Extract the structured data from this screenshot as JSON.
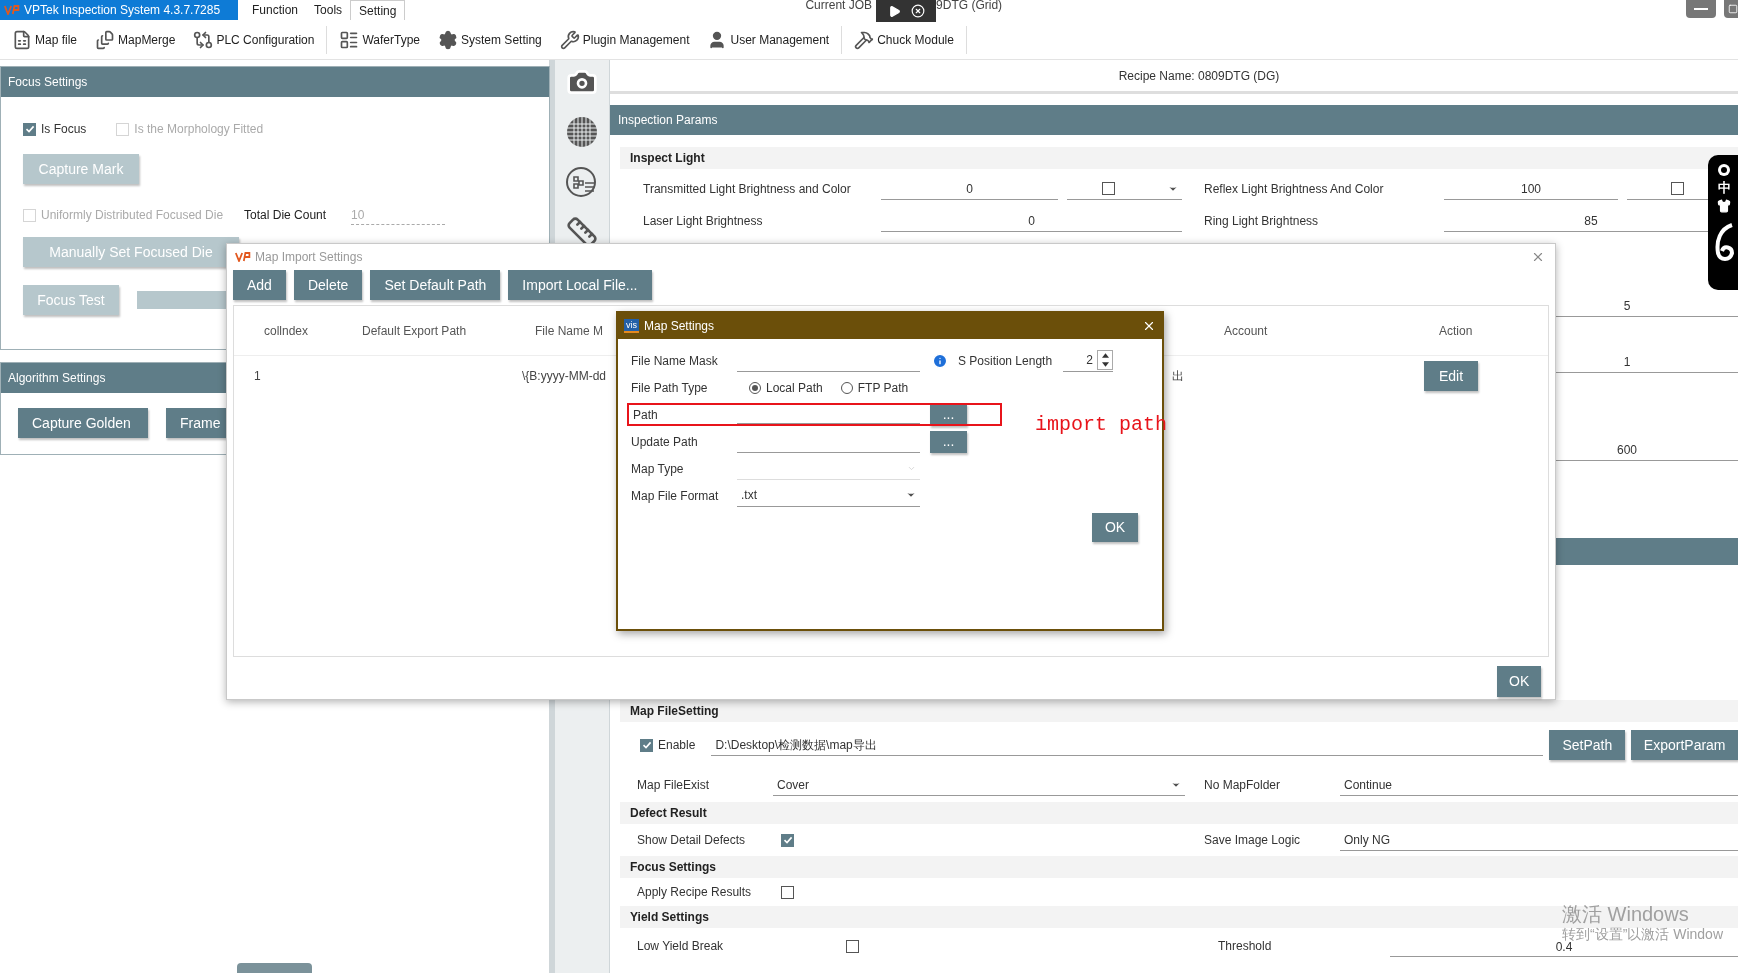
{
  "app": {
    "title": "VPTek Inspection System 4.3.7.7285",
    "job_left": "Current JOB",
    "job_right": "9DTG (Grid)"
  },
  "menus": [
    {
      "label": "Function",
      "selected": false
    },
    {
      "label": "Tools",
      "selected": false
    },
    {
      "label": "Setting",
      "selected": true
    }
  ],
  "toolbar": [
    {
      "label": "Map file"
    },
    {
      "label": "MapMerge"
    },
    {
      "label": "PLC Configuration"
    },
    {
      "label": "WaferType"
    },
    {
      "label": "System Setting"
    },
    {
      "label": "Plugin Management"
    },
    {
      "label": "User Management"
    },
    {
      "label": "Chuck Module"
    }
  ],
  "focus_settings": {
    "title": "Focus Settings",
    "is_focus": {
      "label": "Is Focus",
      "checked": true,
      "disabled": false
    },
    "morphology": {
      "label": "Is the Morphology Fitted",
      "checked": false,
      "disabled": true
    },
    "capture_mark": {
      "label": "Capture Mark",
      "disabled": true
    },
    "uniform": {
      "label": "Uniformly Distributed Focused Die",
      "checked": false,
      "disabled": true
    },
    "total_die_label": "Total Die Count",
    "total_die_value": "10",
    "manual": {
      "label": "Manually Set Focused Die",
      "disabled": true
    },
    "focus_test": {
      "label": "Focus Test",
      "disabled": true
    }
  },
  "algorithm_settings": {
    "title": "Algorithm Settings",
    "buttons": [
      {
        "label": "Capture Golden",
        "disabled": false
      },
      {
        "label": "Frame",
        "disabled": false
      }
    ]
  },
  "recipe": "Recipe Name: 0809DTG (DG)",
  "inspection_params": {
    "title": "Inspection Params",
    "section": "Inspect Light",
    "transmitted": {
      "label": "Transmitted Light Brightness and Color",
      "value": "0",
      "color_checked": false
    },
    "reflex": {
      "label": "Reflex Light Brightness And Color",
      "value": "100",
      "color_checked": false
    },
    "laser": {
      "label": "Laser Light Brightness",
      "value": "0"
    },
    "ring": {
      "label": "Ring Light Brightness",
      "value": "85"
    },
    "hidden_values": [
      "5",
      "1",
      "600"
    ]
  },
  "map_file_setting": {
    "title": "Map FileSetting",
    "enable": {
      "label": "Enable",
      "checked": true
    },
    "path": "D:\\Desktop\\检测数据\\map导出",
    "buttons": [
      "SetPath",
      "ExportParam"
    ],
    "exist_label": "Map FileExist",
    "exist_value": "Cover",
    "folder_label": "No MapFolder",
    "folder_value": "Continue"
  },
  "defect_result": {
    "title": "Defect Result",
    "show_detail": {
      "label": "Show Detail Defects",
      "checked": true
    },
    "save_label": "Save Image Logic",
    "save_value": "Only NG"
  },
  "focus_settings_2": {
    "title": "Focus Settings",
    "apply": {
      "label": "Apply Recipe Results",
      "checked": false
    }
  },
  "yield_settings": {
    "title": "Yield Settings",
    "low_yield": {
      "label": "Low Yield Break",
      "checked": false
    },
    "threshold_label": "Threshold",
    "threshold_value": "0.4"
  },
  "map_import": {
    "title": "Map Import Settings",
    "buttons": [
      "Add",
      "Delete",
      "Set Default Path",
      "Import Local File..."
    ],
    "columns": [
      "collndex",
      "Default Export Path",
      "File Name M",
      "Account",
      "Action"
    ],
    "rows": [
      {
        "index": "1",
        "file_name": "\\{B:yyyy-MM-dd",
        "hidden_tail": "出",
        "action": "Edit"
      }
    ],
    "ok": "OK"
  },
  "map_settings": {
    "title": "Map Settings",
    "logo": "vis",
    "file_name_mask": {
      "label": "File Name Mask"
    },
    "s_position": {
      "label": "S Position Length",
      "value": "2"
    },
    "path_type": {
      "label": "File Path Type",
      "options": [
        {
          "label": "Local Path",
          "selected": true
        },
        {
          "label": "FTP Path",
          "selected": false
        }
      ]
    },
    "path": {
      "label": "Path",
      "button": "..."
    },
    "update_path": {
      "label": "Update Path",
      "button": "..."
    },
    "map_type": {
      "label": "Map Type",
      "disabled": true
    },
    "format": {
      "label": "Map File Format",
      "value": ".txt"
    },
    "ok": "OK"
  },
  "annotation": {
    "text": "import path"
  },
  "ime": {
    "label": "中"
  },
  "os_notice": {
    "title": "激活 Windows",
    "text": "转到“设置”以激活 Window"
  }
}
